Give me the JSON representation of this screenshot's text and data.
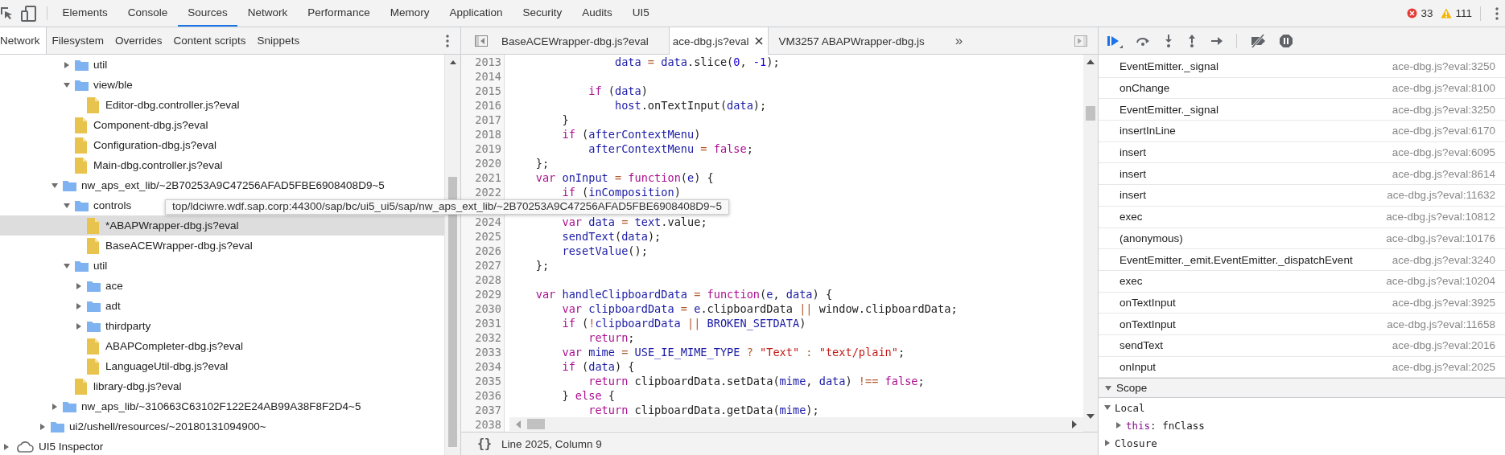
{
  "toolbar": {
    "tabs": [
      {
        "label": "Elements",
        "selected": false
      },
      {
        "label": "Console",
        "selected": false
      },
      {
        "label": "Sources",
        "selected": true
      },
      {
        "label": "Network",
        "selected": false
      },
      {
        "label": "Performance",
        "selected": false
      },
      {
        "label": "Memory",
        "selected": false
      },
      {
        "label": "Application",
        "selected": false
      },
      {
        "label": "Security",
        "selected": false
      },
      {
        "label": "Audits",
        "selected": false
      },
      {
        "label": "UI5",
        "selected": false
      }
    ],
    "error_count": "33",
    "warning_count": "111"
  },
  "navigator": {
    "tabs": [
      {
        "label": "Network",
        "selected": true
      },
      {
        "label": "Filesystem",
        "selected": false
      },
      {
        "label": "Overrides",
        "selected": false
      },
      {
        "label": "Content scripts",
        "selected": false
      },
      {
        "label": "Snippets",
        "selected": false
      }
    ],
    "tree": [
      {
        "children": [
          {
            "children": [
              {
                "children": [
                  {
                    "children": [
                      {
                        "children": [
                          {
                            "label": "util",
                            "kind": "folder",
                            "expanded": false,
                            "selected": false
                          },
                          {
                            "label": "view/ble",
                            "kind": "folder",
                            "expanded": true,
                            "selected": false,
                            "children": [
                              {
                                "label": "Editor-dbg.controller.js?eval",
                                "kind": "file",
                                "selected": false
                              }
                            ]
                          },
                          {
                            "label": "Component-dbg.js?eval",
                            "kind": "file",
                            "selected": false
                          },
                          {
                            "label": "Configuration-dbg.js?eval",
                            "kind": "file",
                            "selected": false
                          },
                          {
                            "label": "Main-dbg.controller.js?eval",
                            "kind": "file",
                            "selected": false
                          }
                        ]
                      },
                      {
                        "label": "nw_aps_ext_lib/~2B70253A9C47256AFAD5FBE6908408D9~5",
                        "kind": "folder",
                        "expanded": true,
                        "selected": false,
                        "children": [
                          {
                            "label": "controls",
                            "kind": "folder",
                            "expanded": true,
                            "selected": false,
                            "children": [
                              {
                                "label": "*ABAPWrapper-dbg.js?eval",
                                "kind": "file",
                                "selected": true
                              },
                              {
                                "label": "BaseACEWrapper-dbg.js?eval",
                                "kind": "file",
                                "selected": false
                              }
                            ]
                          },
                          {
                            "label": "util",
                            "kind": "folder",
                            "expanded": true,
                            "selected": false,
                            "children": [
                              {
                                "label": "ace",
                                "kind": "folder",
                                "expanded": false,
                                "selected": false
                              },
                              {
                                "label": "adt",
                                "kind": "folder",
                                "expanded": false,
                                "selected": false
                              },
                              {
                                "label": "thirdparty",
                                "kind": "folder",
                                "expanded": false,
                                "selected": false
                              },
                              {
                                "label": "ABAPCompleter-dbg.js?eval",
                                "kind": "file",
                                "selected": false
                              },
                              {
                                "label": "LanguageUtil-dbg.js?eval",
                                "kind": "file",
                                "selected": false
                              }
                            ]
                          },
                          {
                            "label": "library-dbg.js?eval",
                            "kind": "file",
                            "selected": false
                          }
                        ]
                      },
                      {
                        "label": "nw_aps_lib/~310663C63102F122E24AB99A38F8F2D4~5",
                        "kind": "folder",
                        "expanded": false,
                        "selected": false
                      }
                    ]
                  },
                  {
                    "label": "ui2/ushell/resources/~20180131094900~",
                    "kind": "folder",
                    "expanded": false,
                    "selected": false
                  }
                ]
              }
            ]
          }
        ]
      },
      {
        "label": "UI5 Inspector",
        "kind": "cloud",
        "expanded": false,
        "selected": false
      }
    ]
  },
  "editor": {
    "tabs": [
      {
        "label": "BaseACEWrapper-dbg.js?eval",
        "selected": false
      },
      {
        "label": "ace-dbg.js?eval",
        "selected": true
      },
      {
        "label": "VM3257 ABAPWrapper-dbg.js",
        "selected": false
      }
    ],
    "overflow": "»",
    "lines": [
      {
        "number": "2013",
        "tokens": [
          {
            "text": "                data",
            "kind": "var"
          },
          {
            "text": " = ",
            "kind": "op"
          },
          {
            "text": "data",
            "kind": "var"
          },
          {
            "text": ".slice(",
            "kind": "plain"
          },
          {
            "text": "0",
            "kind": "num"
          },
          {
            "text": ", ",
            "kind": "plain"
          },
          {
            "text": "-1",
            "kind": "num"
          },
          {
            "text": ");",
            "kind": "plain"
          }
        ]
      },
      {
        "number": "2014"
      },
      {
        "number": "2015",
        "tokens": [
          {
            "text": "            if",
            "kind": "kw"
          },
          {
            "text": " (",
            "kind": "plain"
          },
          {
            "text": "data",
            "kind": "var"
          },
          {
            "text": ")",
            "kind": "plain"
          }
        ]
      },
      {
        "number": "2016",
        "tokens": [
          {
            "text": "                host",
            "kind": "var"
          },
          {
            "text": ".onTextInput(",
            "kind": "plain"
          },
          {
            "text": "data",
            "kind": "var"
          },
          {
            "text": ");",
            "kind": "plain"
          }
        ]
      },
      {
        "number": "2017",
        "tokens": [
          {
            "text": "        }",
            "kind": "plain"
          }
        ]
      },
      {
        "number": "2018",
        "tokens": [
          {
            "text": "        if",
            "kind": "kw"
          },
          {
            "text": " (",
            "kind": "plain"
          },
          {
            "text": "afterContextMenu",
            "kind": "var"
          },
          {
            "text": ")",
            "kind": "plain"
          }
        ]
      },
      {
        "number": "2019",
        "tokens": [
          {
            "text": "            afterContextMenu",
            "kind": "var"
          },
          {
            "text": " = ",
            "kind": "op"
          },
          {
            "text": "false",
            "kind": "kw"
          },
          {
            "text": ";",
            "kind": "plain"
          }
        ]
      },
      {
        "number": "2020",
        "tokens": [
          {
            "text": "    };",
            "kind": "plain"
          }
        ]
      },
      {
        "number": "2021",
        "tokens": [
          {
            "text": "    var ",
            "kind": "kw"
          },
          {
            "text": "onInput",
            "kind": "var"
          },
          {
            "text": " = ",
            "kind": "op"
          },
          {
            "text": "function",
            "kind": "kw"
          },
          {
            "text": "(",
            "kind": "plain"
          },
          {
            "text": "e",
            "kind": "var"
          },
          {
            "text": ") {",
            "kind": "plain"
          }
        ]
      },
      {
        "number": "2022",
        "tokens": [
          {
            "text": "        if",
            "kind": "kw"
          },
          {
            "text": " (",
            "kind": "plain"
          },
          {
            "text": "inComposition",
            "kind": "var"
          },
          {
            "text": ")",
            "kind": "plain"
          }
        ]
      },
      {
        "kind": "tooltip",
        "text": "top/ldciwre.wdf.sap.corp:44300/sap/bc/ui5_ui5/sap/nw_aps_ext_lib/~2B70253A9C47256AFAD5FBE6908408D9~5"
      },
      {
        "number": "2024",
        "tokens": [
          {
            "text": "        var ",
            "kind": "kw"
          },
          {
            "text": "data",
            "kind": "var"
          },
          {
            "text": " = ",
            "kind": "op"
          },
          {
            "text": "text",
            "kind": "var"
          },
          {
            "text": ".value;",
            "kind": "plain"
          }
        ]
      },
      {
        "number": "2025",
        "tokens": [
          {
            "text": "        sendText",
            "kind": "var"
          },
          {
            "text": "(",
            "kind": "plain"
          },
          {
            "text": "data",
            "kind": "var"
          },
          {
            "text": ");",
            "kind": "plain"
          }
        ]
      },
      {
        "number": "2026",
        "tokens": [
          {
            "text": "        resetValue",
            "kind": "var"
          },
          {
            "text": "();",
            "kind": "plain"
          }
        ]
      },
      {
        "number": "2027",
        "tokens": [
          {
            "text": "    };",
            "kind": "plain"
          }
        ]
      },
      {
        "number": "2028"
      },
      {
        "number": "2029",
        "tokens": [
          {
            "text": "    var ",
            "kind": "kw"
          },
          {
            "text": "handleClipboardData",
            "kind": "var"
          },
          {
            "text": " = ",
            "kind": "op"
          },
          {
            "text": "function",
            "kind": "kw"
          },
          {
            "text": "(",
            "kind": "plain"
          },
          {
            "text": "e",
            "kind": "var"
          },
          {
            "text": ", ",
            "kind": "plain"
          },
          {
            "text": "data",
            "kind": "var"
          },
          {
            "text": ") {",
            "kind": "plain"
          }
        ]
      },
      {
        "number": "2030",
        "tokens": [
          {
            "text": "        var ",
            "kind": "kw"
          },
          {
            "text": "clipboardData",
            "kind": "var"
          },
          {
            "text": " = ",
            "kind": "op"
          },
          {
            "text": "e",
            "kind": "var"
          },
          {
            "text": ".clipboardData ",
            "kind": "plain"
          },
          {
            "text": "||",
            "kind": "op"
          },
          {
            "text": " window.clipboardData;",
            "kind": "plain"
          }
        ]
      },
      {
        "number": "2031",
        "tokens": [
          {
            "text": "        if",
            "kind": "kw"
          },
          {
            "text": " (",
            "kind": "plain"
          },
          {
            "text": "!",
            "kind": "op"
          },
          {
            "text": "clipboardData ",
            "kind": "var"
          },
          {
            "text": "|| ",
            "kind": "op"
          },
          {
            "text": "BROKEN_SETDATA",
            "kind": "var"
          },
          {
            "text": ")",
            "kind": "plain"
          }
        ]
      },
      {
        "number": "2032",
        "tokens": [
          {
            "text": "            return",
            "kind": "kw"
          },
          {
            "text": ";",
            "kind": "plain"
          }
        ]
      },
      {
        "number": "2033",
        "tokens": [
          {
            "text": "        var ",
            "kind": "kw"
          },
          {
            "text": "mime",
            "kind": "var"
          },
          {
            "text": " = ",
            "kind": "op"
          },
          {
            "text": "USE_IE_MIME_TYPE",
            "kind": "var"
          },
          {
            "text": " ? ",
            "kind": "op"
          },
          {
            "text": "\"Text\"",
            "kind": "str"
          },
          {
            "text": " : ",
            "kind": "op"
          },
          {
            "text": "\"text/plain\"",
            "kind": "str"
          },
          {
            "text": ";",
            "kind": "plain"
          }
        ]
      },
      {
        "number": "2034",
        "tokens": [
          {
            "text": "        if",
            "kind": "kw"
          },
          {
            "text": " (",
            "kind": "plain"
          },
          {
            "text": "data",
            "kind": "var"
          },
          {
            "text": ") {",
            "kind": "plain"
          }
        ]
      },
      {
        "number": "2035",
        "tokens": [
          {
            "text": "            return",
            "kind": "kw"
          },
          {
            "text": " clipboardData.setData(",
            "kind": "plain"
          },
          {
            "text": "mime",
            "kind": "var"
          },
          {
            "text": ", ",
            "kind": "plain"
          },
          {
            "text": "data",
            "kind": "var"
          },
          {
            "text": ") ",
            "kind": "plain"
          },
          {
            "text": "!== ",
            "kind": "op"
          },
          {
            "text": "false",
            "kind": "kw"
          },
          {
            "text": ";",
            "kind": "plain"
          }
        ]
      },
      {
        "number": "2036",
        "tokens": [
          {
            "text": "        } ",
            "kind": "plain"
          },
          {
            "text": "else",
            "kind": "kw"
          },
          {
            "text": " {",
            "kind": "plain"
          }
        ]
      },
      {
        "number": "2037",
        "tokens": [
          {
            "text": "            return",
            "kind": "kw"
          },
          {
            "text": " clipboardData.getData(",
            "kind": "plain"
          },
          {
            "text": "mime",
            "kind": "var"
          },
          {
            "text": ");",
            "kind": "plain"
          }
        ]
      },
      {
        "number": "2038"
      }
    ],
    "format_button": "{}",
    "status": "Line 2025, Column 9"
  },
  "debugger": {
    "call_stack": [
      {
        "function": "EventEmitter._signal",
        "location": "ace-dbg.js?eval:3250"
      },
      {
        "function": "onChange",
        "location": "ace-dbg.js?eval:8100"
      },
      {
        "function": "EventEmitter._signal",
        "location": "ace-dbg.js?eval:3250"
      },
      {
        "function": "insertInLine",
        "location": "ace-dbg.js?eval:6170"
      },
      {
        "function": "insert",
        "location": "ace-dbg.js?eval:6095"
      },
      {
        "function": "insert",
        "location": "ace-dbg.js?eval:8614"
      },
      {
        "function": "insert",
        "location": "ace-dbg.js?eval:11632"
      },
      {
        "function": "exec",
        "location": "ace-dbg.js?eval:10812"
      },
      {
        "function": "(anonymous)",
        "location": "ace-dbg.js?eval:10176"
      },
      {
        "function": "EventEmitter._emit.EventEmitter._dispatchEvent",
        "location": "ace-dbg.js?eval:3240"
      },
      {
        "function": "exec",
        "location": "ace-dbg.js?eval:10204"
      },
      {
        "function": "onTextInput",
        "location": "ace-dbg.js?eval:3925"
      },
      {
        "function": "onTextInput",
        "location": "ace-dbg.js?eval:11658"
      },
      {
        "function": "sendText",
        "location": "ace-dbg.js?eval:2016"
      },
      {
        "function": "onInput",
        "location": "ace-dbg.js?eval:2025"
      }
    ],
    "scope": {
      "title": "Scope",
      "expanded": true,
      "sections": [
        {
          "label": "Local",
          "expanded": true,
          "children": [
            {
              "name": "this",
              "separator": ":",
              "value": "fnClass",
              "expanded": false
            }
          ]
        },
        {
          "label": "Closure",
          "expanded": false
        }
      ]
    }
  }
}
